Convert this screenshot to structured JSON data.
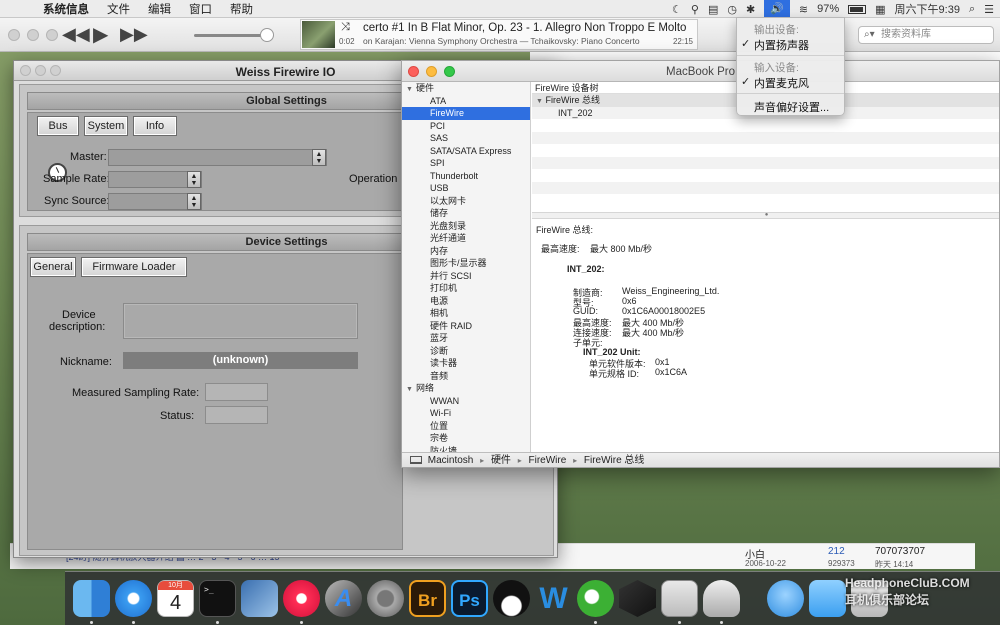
{
  "menubar": {
    "apple": "",
    "items": [
      "系统信息",
      "文件",
      "编辑",
      "窗口",
      "帮助"
    ],
    "battery": "97%",
    "clock": "周六下午9:39"
  },
  "itunes": {
    "track_title": "certo #1 In B Flat Minor, Op. 23 - 1. Allegro Non Troppo E Molto",
    "track_artist": "on Karajan: Vienna Symphony Orchestra — Tchaikovsky: Piano Concerto",
    "elapsed": "0:02",
    "remaining": "22:15",
    "search_placeholder": "搜索资料库",
    "volume_level": 0.9
  },
  "volume_menu": {
    "output_header": "输出设备:",
    "output_item": "内置扬声器",
    "input_header": "输入设备:",
    "input_item": "内置麦克风",
    "prefs": "声音偏好设置..."
  },
  "weiss": {
    "title": "Weiss Firewire IO",
    "global_settings": "Global Settings",
    "tabs": [
      "Bus",
      "System",
      "Info"
    ],
    "master_label": "Master:",
    "sample_rate_label": "Sample Rate:",
    "sync_source_label": "Sync Source:",
    "operation_mode_label": "Operation M",
    "device_settings": "Device Settings",
    "device_tabs": [
      "General",
      "Firmware Loader"
    ],
    "device_description_label_1": "Device",
    "device_description_label_2": "description:",
    "nickname_label": "Nickname:",
    "nickname_value": "(unknown)",
    "measured_rate_label": "Measured Sampling Rate:",
    "status_label": "Status:"
  },
  "sysinfo": {
    "title": "MacBook Pro",
    "sidebar": [
      {
        "label": "硬件",
        "cat": true
      },
      {
        "label": "ATA"
      },
      {
        "label": "FireWire",
        "selected": true
      },
      {
        "label": "PCI"
      },
      {
        "label": "SAS"
      },
      {
        "label": "SATA/SATA Express"
      },
      {
        "label": "SPI"
      },
      {
        "label": "Thunderbolt"
      },
      {
        "label": "USB"
      },
      {
        "label": "以太网卡"
      },
      {
        "label": "储存"
      },
      {
        "label": "光盘刻录"
      },
      {
        "label": "光纤通道"
      },
      {
        "label": "内存"
      },
      {
        "label": "图形卡/显示器"
      },
      {
        "label": "并行 SCSI"
      },
      {
        "label": "打印机"
      },
      {
        "label": "电源"
      },
      {
        "label": "相机"
      },
      {
        "label": "硬件 RAID"
      },
      {
        "label": "蓝牙"
      },
      {
        "label": "诊断"
      },
      {
        "label": "读卡器"
      },
      {
        "label": "音频"
      },
      {
        "label": "网络",
        "cat": true
      },
      {
        "label": "WWAN"
      },
      {
        "label": "Wi-Fi"
      },
      {
        "label": "位置"
      },
      {
        "label": "宗卷"
      },
      {
        "label": "防火墙"
      }
    ],
    "tree_header": "FireWire 设备树",
    "tree_bus": "FireWire 总线",
    "tree_device": "INT_202",
    "detail": {
      "section": "FireWire 总线:",
      "max_speed_label": "最高速度:",
      "max_speed_value": "最大 800 Mb/秒",
      "device": "INT_202:",
      "manufacturer_label": "制造商:",
      "manufacturer_value": "Weiss_Engineering_Ltd.",
      "model_label": "型号:",
      "model_value": "0x6",
      "guid_label": "GUID:",
      "guid_value": "0x1C6A00018002E5",
      "max_speed2_label": "最高速度:",
      "max_speed2_value": "最大 400 Mb/秒",
      "conn_speed_label": "连接速度:",
      "conn_speed_value": "最大 400 Mb/秒",
      "subunit_label": "子单元:",
      "unit": "INT_202 Unit:",
      "sw_version_label": "单元软件版本:",
      "sw_version_value": "0x1",
      "spec_id_label": "单元规格 ID:",
      "spec_id_value": "0x1C6A"
    },
    "path": [
      "Macintosh",
      "硬件",
      "FireWire",
      "FireWire 总线"
    ]
  },
  "background": {
    "link": "[24町] 随乔耳机放大器介绍 ▤ … 2 · 3 · 4 · 5 · 6 … 15",
    "user": "小白",
    "date": "2006-10-22",
    "replies": "212",
    "views": "929373",
    "last_id": "707073707",
    "last_time": "昨天 14:14"
  },
  "dock": {
    "calendar_month": "10月",
    "calendar_day": "4"
  },
  "watermark": {
    "line1": "HeadphoneCluB.COM",
    "line2": "耳机俱乐部论坛"
  },
  "colors": {
    "accent": "#2f6fe0",
    "sidebar_selection": "#2f6fe0"
  }
}
